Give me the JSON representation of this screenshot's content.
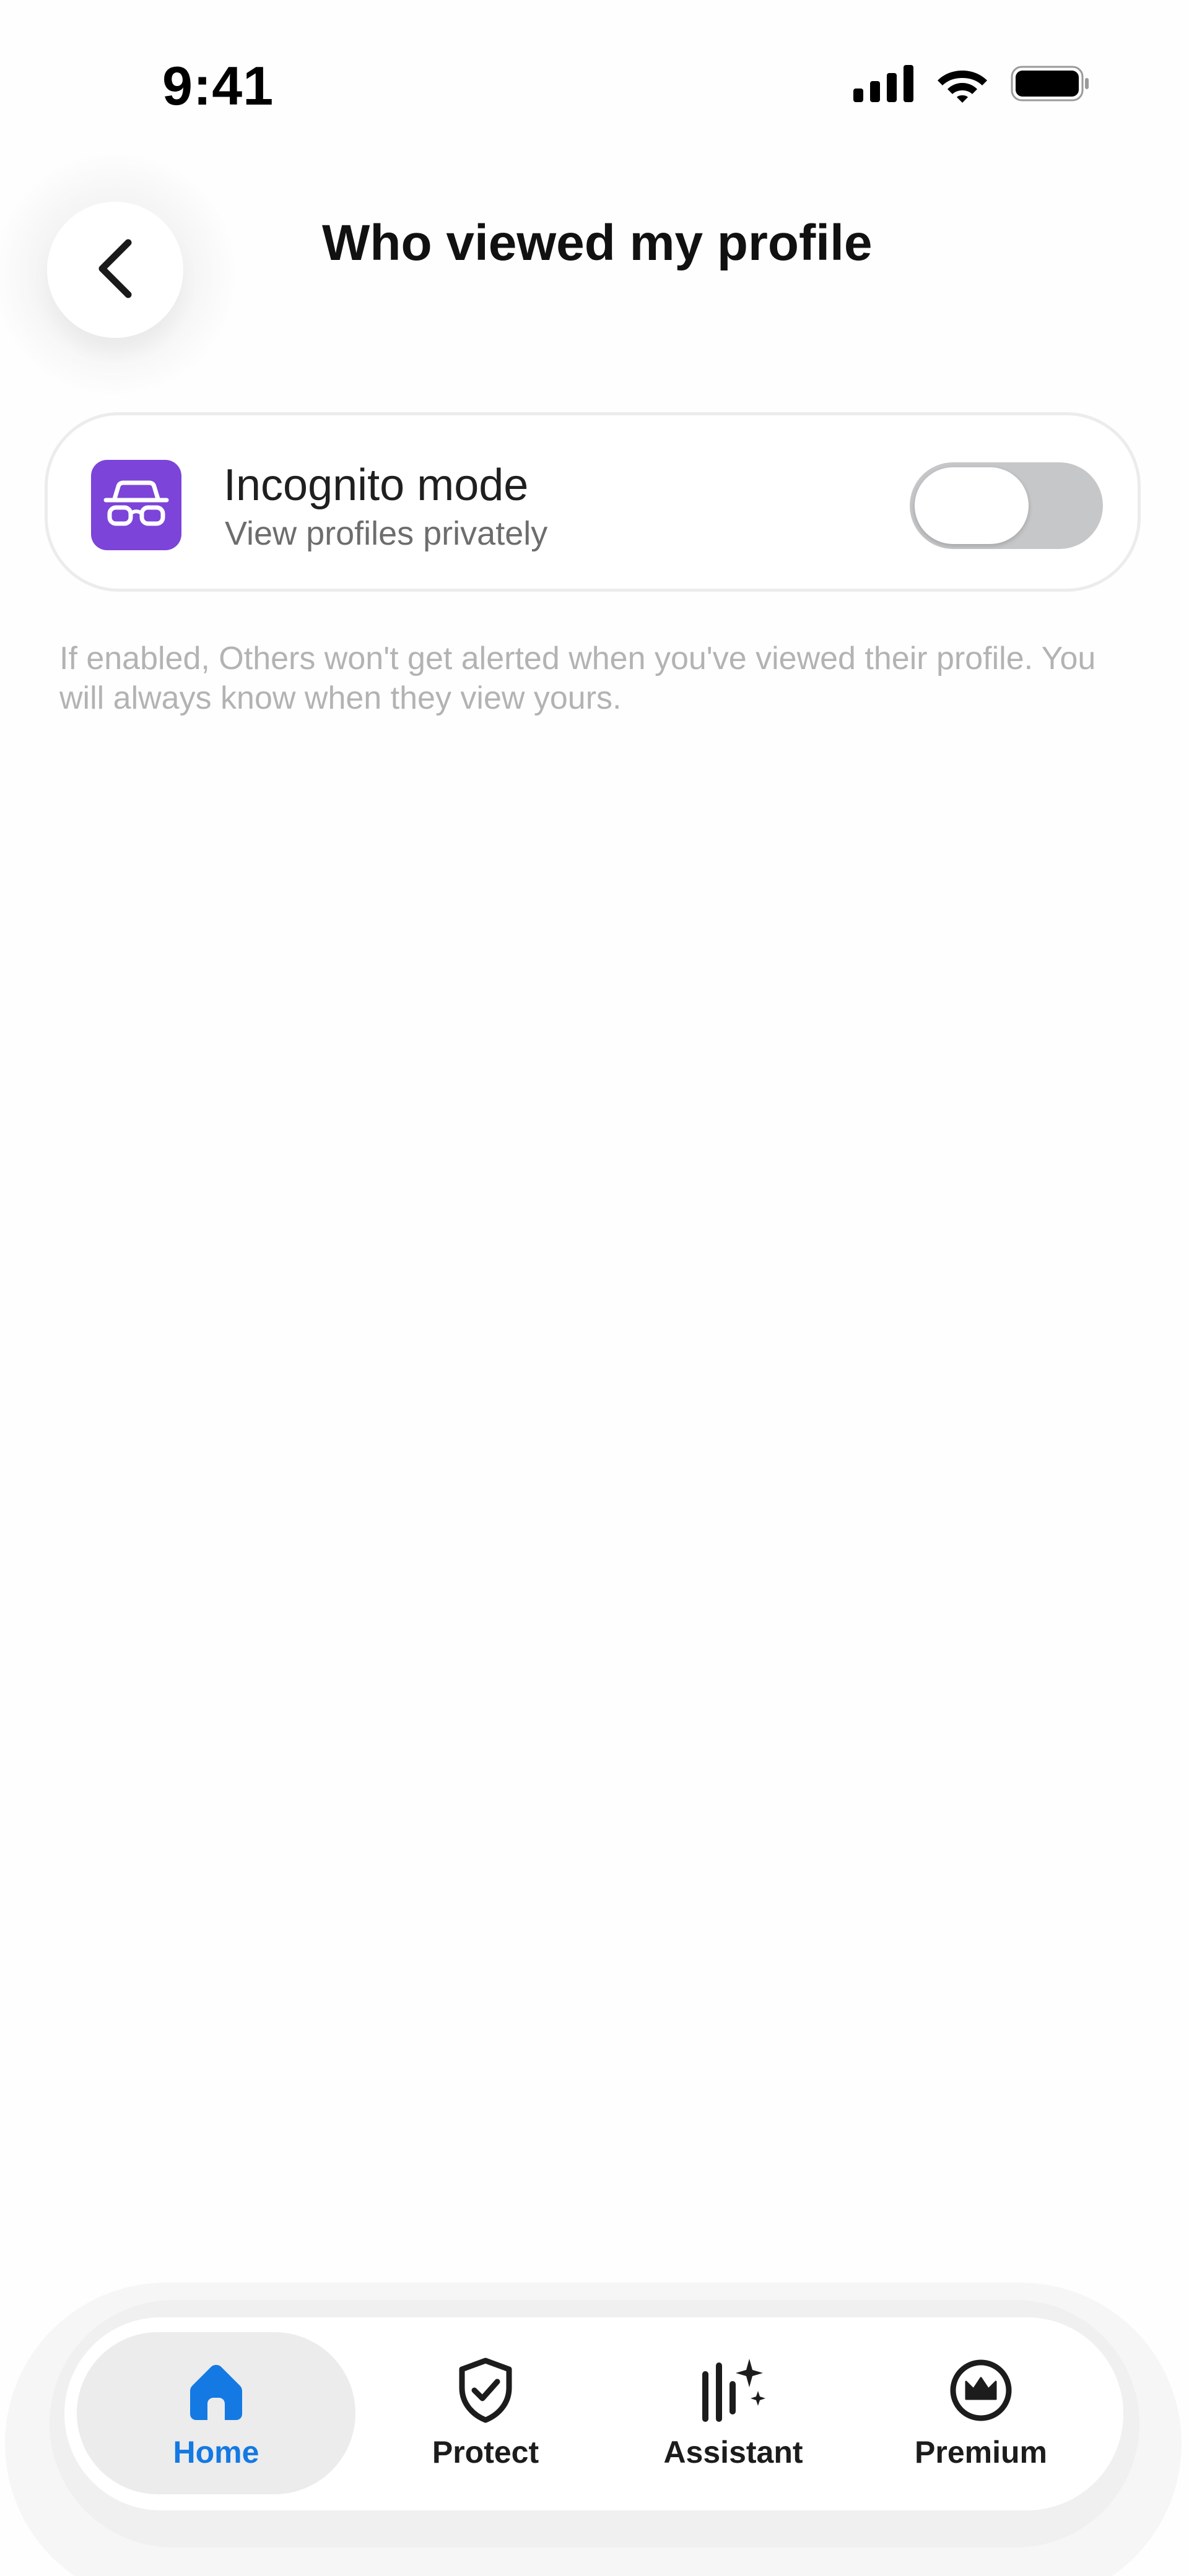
{
  "status_bar": {
    "time": "9:41",
    "icons": [
      "signal-icon",
      "wifi-icon",
      "battery-icon"
    ]
  },
  "header": {
    "back_icon": "chevron-left-icon",
    "title": "Who viewed my profile"
  },
  "incognito": {
    "icon": "incognito-glasses-icon",
    "title": "Incognito mode",
    "subtitle": "View profiles privately",
    "enabled": false,
    "accent_color": "#7C44D8"
  },
  "help_text": "If enabled, Others won't get alerted when you've viewed their profile. You will always know when they view yours.",
  "tabbar": {
    "active_color": "#1479E3",
    "tabs": [
      {
        "label": "Home",
        "icon": "home-icon",
        "active": true
      },
      {
        "label": "Protect",
        "icon": "shield-check-icon",
        "active": false
      },
      {
        "label": "Assistant",
        "icon": "sparkle-bars-icon",
        "active": false
      },
      {
        "label": "Premium",
        "icon": "crown-icon",
        "active": false
      }
    ]
  }
}
